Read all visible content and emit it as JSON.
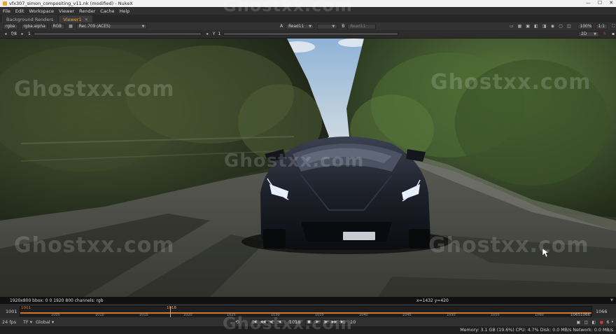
{
  "window": {
    "title": "vfx307_simon_compositing_v11.nk (modified) - NukeX",
    "buttons": [
      "—",
      "☐",
      "✕"
    ]
  },
  "menu": [
    "File",
    "Edit",
    "Workspace",
    "Viewer",
    "Render",
    "Cache",
    "Help"
  ],
  "tabs": [
    {
      "label": "Background Renders",
      "active": false
    },
    {
      "label": "Viewer1",
      "active": true
    }
  ],
  "viewer_bar": {
    "channels": "rgba",
    "alpha": "rgba.alpha",
    "display": "RGB",
    "colorspace": "Rec.709 (ACES)",
    "input_a_label": "A",
    "input_a": "Read11",
    "input_b_label": "B",
    "input_b": "Read11",
    "zoom": "100%",
    "ratio": "1:1",
    "dim": "2D"
  },
  "viewer_bar2": {
    "fstop": "f/8",
    "frame_value": "1",
    "gamma_label": "Y",
    "gamma_value": "1"
  },
  "viewport": {
    "format_info": "1920x800  bbox: 0 0 1920 800 channels: rgb",
    "coords": "x=1432 y=420"
  },
  "timeline": {
    "start": "1001",
    "end": "1066",
    "in_label": "1001",
    "out_label": "10651066",
    "current_frame": "1018",
    "current_fraction": 0.262,
    "ticks": [
      "1001",
      "1005",
      "1010",
      "1015",
      "1020",
      "1025",
      "1030",
      "1035",
      "1040",
      "1045",
      "1050",
      "1055",
      "1060"
    ]
  },
  "playback": {
    "fps": "24 fps",
    "tf": "TF",
    "global": "Global",
    "frame": "1018",
    "step": "10",
    "count": "6"
  },
  "status": "Memory: 3.1 GB (19.6%)  CPU: 4.7%  Disk: 0.0 MB/s  Network: 0.0 MB/s",
  "watermark": "Ghostxx.com",
  "colors": {
    "accent": "#f3a43b",
    "timeline_bar": "#d2762a"
  }
}
